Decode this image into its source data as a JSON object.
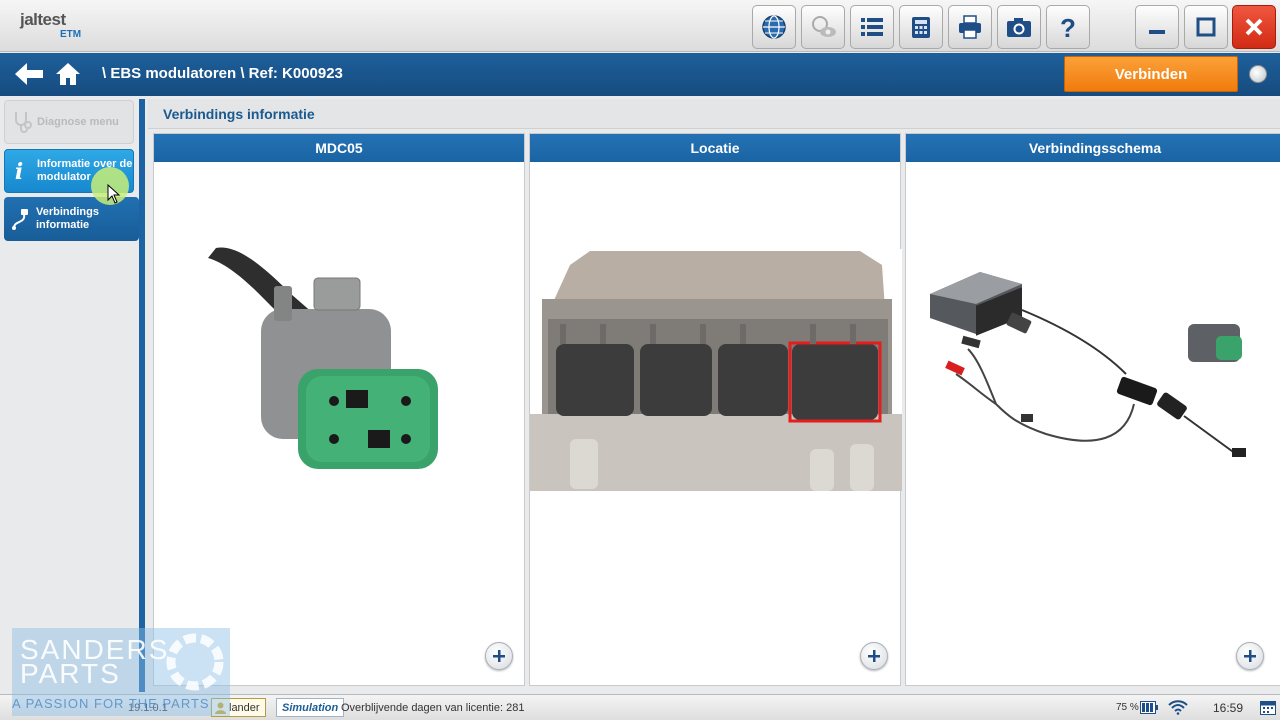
{
  "app": {
    "logo_brand": "jaltest",
    "logo_sub": "ETM"
  },
  "toolbar": {
    "icons": [
      "globe-icon",
      "eye-icon",
      "list-icon",
      "calculator-icon",
      "printer-icon",
      "camera-icon",
      "help-icon",
      "minimize-icon",
      "maximize-icon",
      "close-icon"
    ]
  },
  "navbar": {
    "breadcrumb": "\\ EBS modulatoren \\ Ref: K000923",
    "connect_label": "Verbinden"
  },
  "sidebar": {
    "items": [
      {
        "label": "Diagnose menu",
        "state": "disabled"
      },
      {
        "label": "Informatie over de modulator",
        "state": "active"
      },
      {
        "label": "Verbindings informatie",
        "state": "normal"
      }
    ]
  },
  "content": {
    "title": "Verbindings informatie",
    "panels": [
      {
        "title": "MDC05"
      },
      {
        "title": "Locatie"
      },
      {
        "title": "Verbindingsschema"
      }
    ]
  },
  "statusbar": {
    "version": "19.1.0.1",
    "user": "lander",
    "mode": "Simulation",
    "license": "Overblijvende dagen van licentie: 281",
    "battery": "75 %",
    "time": "16:59"
  },
  "watermark": {
    "line1": "SANDERS",
    "line2": "PARTS",
    "tagline": "A PASSION FOR THE PARTS"
  },
  "colors": {
    "nav_blue": "#1e5f9b",
    "accent_orange": "#f07b0c",
    "active_sidebar": "#1788cf",
    "connector_green": "#3aa36b"
  }
}
